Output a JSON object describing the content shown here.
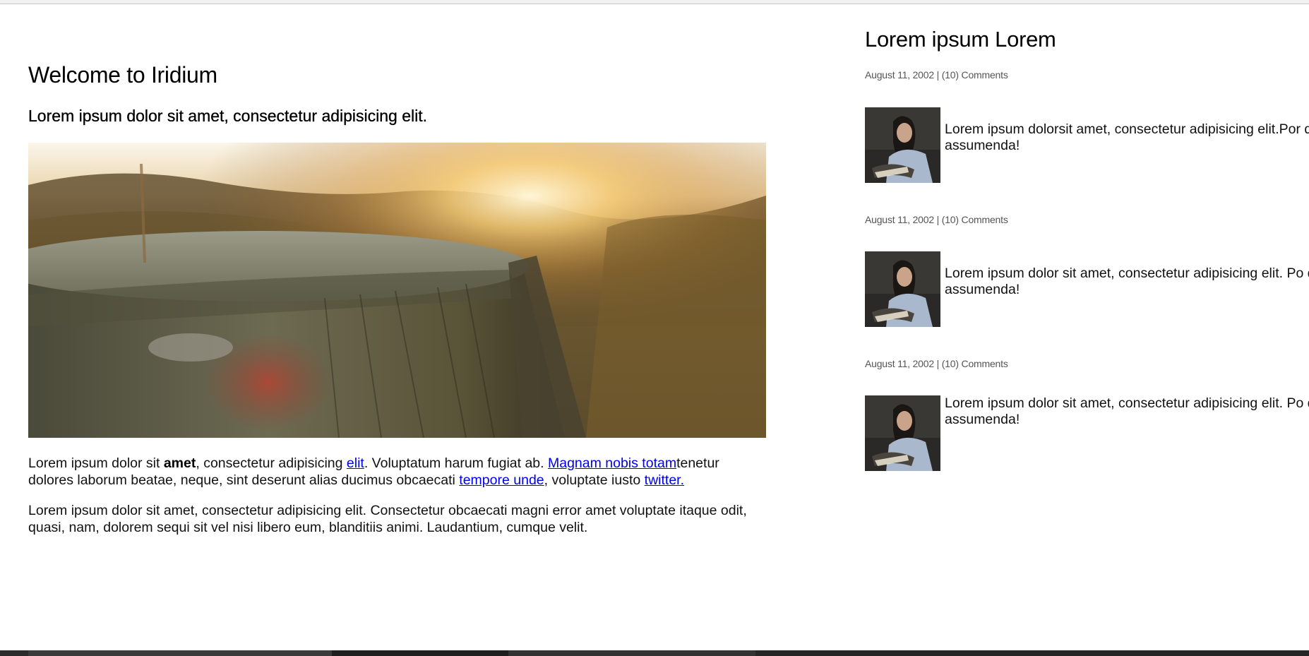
{
  "main": {
    "title": "Welcome to Iridium",
    "subtitle": "Lorem ipsum dolor sit amet, consectetur adipisicing elit.",
    "hero_image": "tree-stump-sunset-photo",
    "paragraph1": {
      "t1": "Lorem ipsum dolor sit ",
      "bold": "amet",
      "t2": ", consectetur adipisicing ",
      "link1": "elit",
      "t3": ". Voluptatum harum fugiat ab. ",
      "link2": "Magnam nobis totam",
      "t4": "tenetur dolores laborum beatae, neque, sint deserunt alias ducimus obcaecati ",
      "link3": "tempore unde",
      "t5": ", voluptate iusto ",
      "link4": "twitter."
    },
    "paragraph2": "Lorem ipsum dolor sit amet, consectetur adipisicing elit. Consectetur obcaecati magni error amet voluptate itaque odit, quasi, nam, dolorem sequi sit vel nisi libero eum, blanditiis animi. Laudantium, cumque velit."
  },
  "sidebar": {
    "title": "Lorem ipsum Lorem",
    "posts": [
      {
        "meta": "August 11, 2002 | (10) Comments",
        "thumb": "woman-reading-photo",
        "excerpt": "Lorem ipsum dolorsit amet, consectetur adipisicing elit.Por quo sunt, assumenda!"
      },
      {
        "meta": "August 11, 2002 | (10) Comments",
        "thumb": "woman-reading-photo",
        "excerpt": "Lorem ipsum dolor sit amet, consectetur adipisicing elit. Po quo sunt, assumenda!"
      },
      {
        "meta": "August 11, 2002 | (10) Comments",
        "thumb": "woman-reading-photo",
        "excerpt": "Lorem ipsum dolor sit amet, consectetur adipisicing elit. Po quo sunt, assumenda!"
      }
    ]
  },
  "colors": {
    "link": "#0000ee",
    "meta": "#555555",
    "text": "#111111"
  }
}
